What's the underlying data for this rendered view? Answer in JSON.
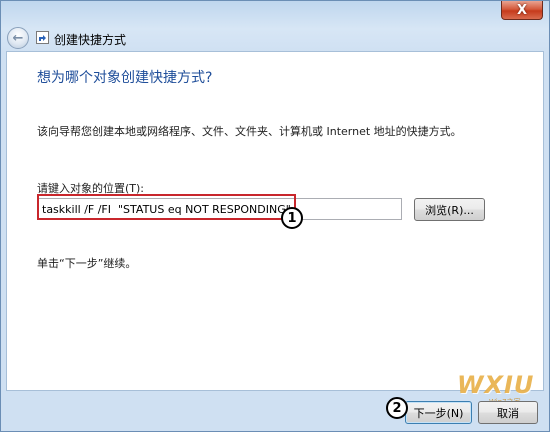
{
  "window": {
    "title": "创建快捷方式",
    "close_label": "X"
  },
  "main": {
    "heading": "想为哪个对象创建快捷方式?",
    "description": "该向导帮您创建本地或网络程序、文件、文件夹、计算机或 Internet 地址的快捷方式。",
    "location_label": "请键入对象的位置(T):",
    "location_value": "taskkill /F /FI  \"STATUS eq NOT RESPONDING\"",
    "browse_label": "浏览(R)...",
    "hint": "单击“下一步”继续。"
  },
  "footer": {
    "next_label": "下一步(N)",
    "cancel_label": "取消"
  },
  "annotations": {
    "step1": "1",
    "step2": "2"
  },
  "watermark": {
    "text": "WXIU",
    "sub": "Win7之家"
  },
  "colors": {
    "heading": "#1f4e9a",
    "highlight": "#c8262c",
    "close_button": "#c63b1c"
  }
}
